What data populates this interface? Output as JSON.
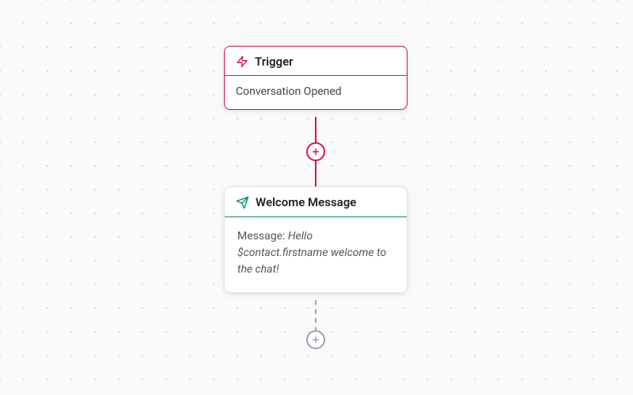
{
  "colors": {
    "accent_pink": "#d1145a",
    "accent_teal": "#138a77",
    "muted_gray": "#9ca3af"
  },
  "nodes": {
    "trigger": {
      "icon": "lightning-icon",
      "title": "Trigger",
      "body": "Conversation Opened"
    },
    "welcome": {
      "icon": "send-icon",
      "title": "Welcome Message",
      "message_label": "Message: ",
      "message_text": "Hello $contact.firstname welcome to the chat!"
    }
  },
  "connectors": {
    "top": {
      "style": "solid",
      "color": "accent_pink",
      "has_add_button": true
    },
    "bottom": {
      "style": "dashed",
      "color": "muted_gray",
      "has_add_button": true
    }
  }
}
